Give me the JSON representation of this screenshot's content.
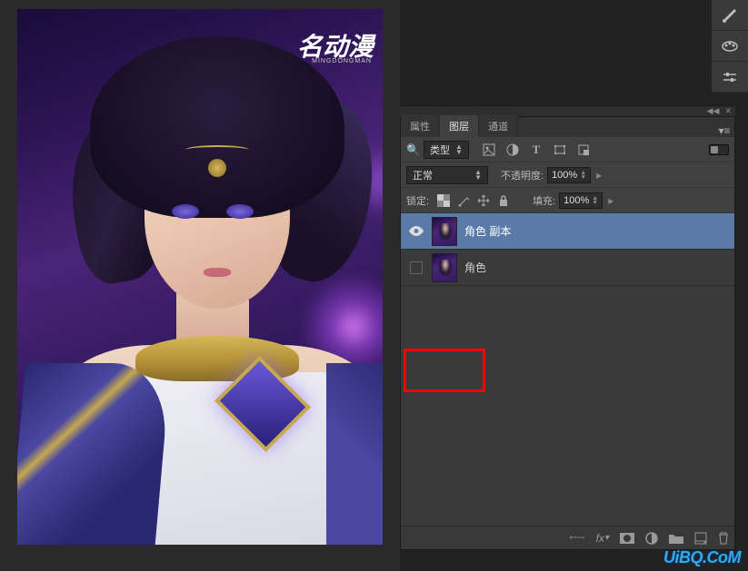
{
  "canvas": {
    "logo": "名动漫",
    "logo_sub": "MINGDONGMAN"
  },
  "panel": {
    "tabs": {
      "properties": "属性",
      "layers": "图层",
      "channels": "通道"
    },
    "filter": {
      "kind_label": "类型"
    },
    "blend": {
      "mode": "正常",
      "opacity_label": "不透明度:",
      "opacity_value": "100%"
    },
    "lock": {
      "label": "锁定:",
      "fill_label": "填充:",
      "fill_value": "100%"
    },
    "layers": [
      {
        "name": "角色 副本",
        "visible": true,
        "selected": true
      },
      {
        "name": "角色",
        "visible": false,
        "selected": false
      }
    ]
  },
  "watermark": "UiBQ.CoM"
}
